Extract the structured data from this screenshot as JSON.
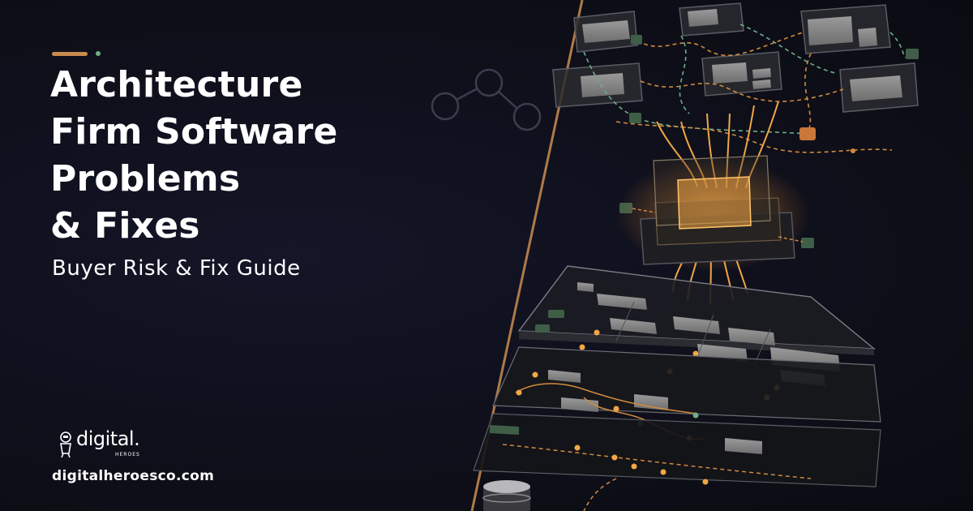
{
  "hero": {
    "title_lines": [
      "Architecture",
      "Firm Software",
      "Problems",
      "& Fixes"
    ],
    "subtitle": "Buyer Risk & Fix Guide"
  },
  "brand": {
    "logo_word": "digital.",
    "logo_sub": "HEROES",
    "url": "digitalheroesco.com"
  },
  "colors": {
    "background": "#0f1019",
    "accent_orange": "#c98a4e",
    "accent_green": "#6fae86",
    "glow": "#f0a040",
    "text": "#ffffff"
  },
  "icons": [
    "logo-mascot-icon",
    "connector-nodes-icon",
    "database-icon"
  ]
}
